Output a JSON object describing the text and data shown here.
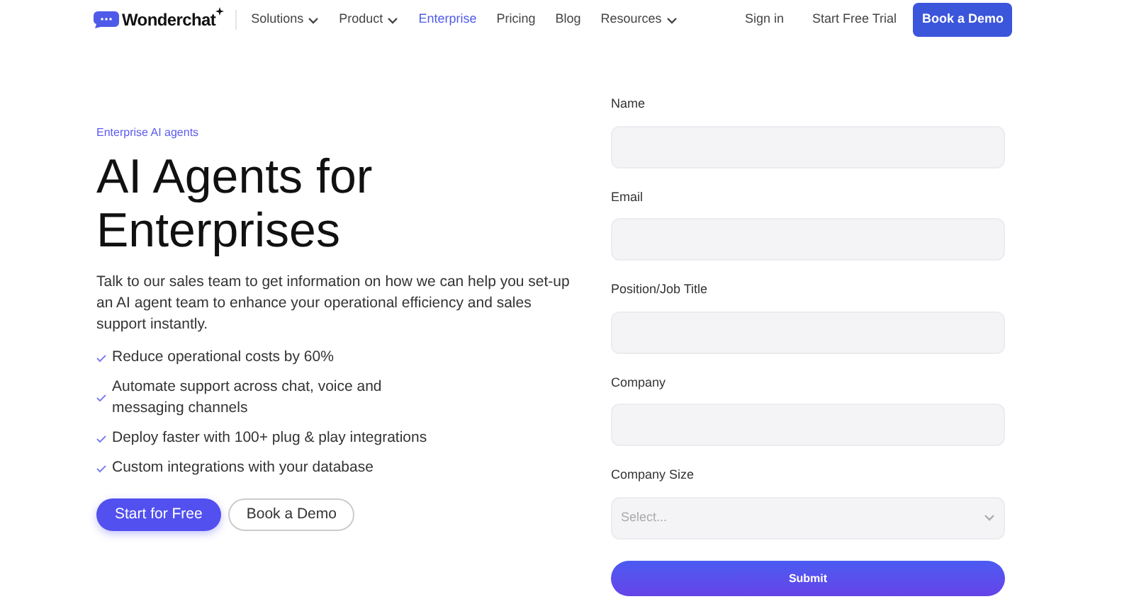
{
  "brand": {
    "name": "Wonderchat"
  },
  "nav": [
    {
      "label": "Solutions",
      "kind": "dropdown",
      "selected": false
    },
    {
      "label": "Product",
      "kind": "dropdown",
      "selected": false
    },
    {
      "label": "Enterprise",
      "kind": "link",
      "selected": true
    },
    {
      "label": "Pricing",
      "kind": "link",
      "selected": false
    },
    {
      "label": "Blog",
      "kind": "link",
      "selected": false
    },
    {
      "label": "Resources",
      "kind": "dropdown",
      "selected": false
    }
  ],
  "header_actions": {
    "sign_in": "Sign in",
    "trial": "Start Free Trial",
    "demo": "Book a Demo"
  },
  "hero": {
    "eyebrow": "Enterprise AI agents",
    "title": "AI Agents for Enterprises",
    "description": "Talk to our sales team to get information on how we can help you set-up an AI agent team to enhance your operational efficiency and sales support instantly.",
    "benefits": [
      "Reduce operational costs by 60%",
      "Automate support across chat, voice and messaging channels",
      "Deploy faster with 100+ plug & play integrations",
      "Custom integrations with your database"
    ],
    "primary_button": "Start for Free",
    "secondary_button": "Book a Demo"
  },
  "form": {
    "fields": [
      {
        "label": "Name",
        "kind": "input"
      },
      {
        "label": "Email",
        "kind": "input"
      },
      {
        "label": "Position/Job Title",
        "kind": "input"
      },
      {
        "label": "Company",
        "kind": "input"
      },
      {
        "label": "Company Size",
        "kind": "select",
        "placeholder": "Select..."
      }
    ],
    "submit": "Submit"
  }
}
